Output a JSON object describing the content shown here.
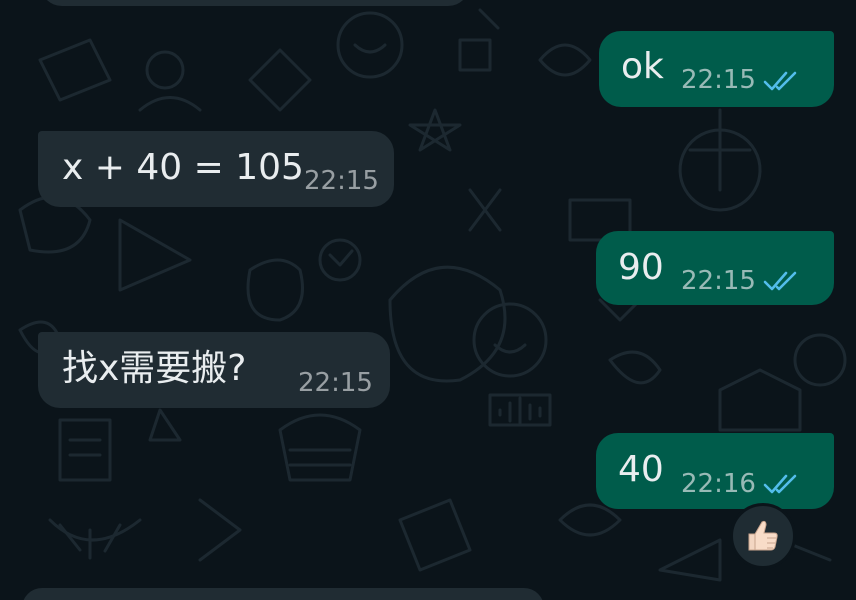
{
  "messages": [
    {
      "id": "m1",
      "direction": "outgoing",
      "text": "ok",
      "time": "22:15",
      "status": "read"
    },
    {
      "id": "m2",
      "direction": "incoming",
      "text": "x + 40 = 105",
      "time": "22:15"
    },
    {
      "id": "m3",
      "direction": "outgoing",
      "text": "90",
      "time": "22:15",
      "status": "read"
    },
    {
      "id": "m4",
      "direction": "incoming",
      "text": "找x需要搬?",
      "time": "22:15"
    },
    {
      "id": "m5",
      "direction": "outgoing",
      "text": "40",
      "time": "22:16",
      "status": "read"
    }
  ],
  "reaction": {
    "emoji": "thumbs-up-icon"
  },
  "colors": {
    "background": "#0b141a",
    "incoming_bubble": "#202c33",
    "outgoing_bubble": "#005c4b",
    "read_ticks": "#53bdeb"
  }
}
